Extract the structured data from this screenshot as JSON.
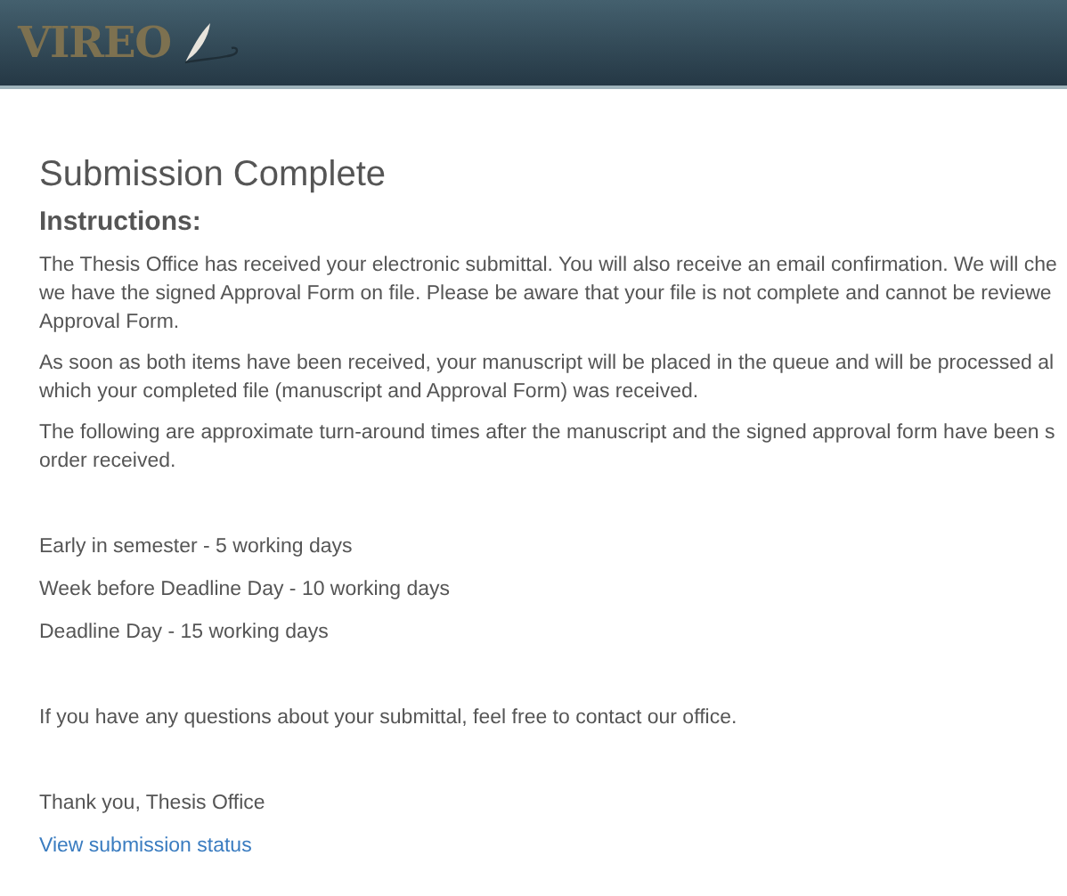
{
  "header": {
    "logo": "VIREO"
  },
  "title": "Submission Complete",
  "subtitle": "Instructions:",
  "paragraphs": [
    {
      "lines": [
        "The Thesis Office has received your electronic submittal. You will also receive an email confirmation. We will che",
        "we have the signed Approval Form on file. Please be aware that your file is not complete and cannot be reviewe",
        "Approval Form."
      ]
    },
    {
      "lines": [
        "As soon as both items have been received, your manuscript will be placed in the queue and will be processed al",
        "which your completed file (manuscript and Approval Form) was received."
      ]
    },
    {
      "lines": [
        "The following are approximate turn-around times after the manuscript and the signed approval form have been s",
        "order received."
      ]
    }
  ],
  "turnaround": [
    "Early in semester - 5 working days",
    "Week before Deadline Day - 10 working days",
    "Deadline Day - 15 working days"
  ],
  "questions": "If you have any questions about your submittal, feel free to contact our office.",
  "signoff": "Thank you, Thesis Office",
  "status_link": "View submission status"
}
